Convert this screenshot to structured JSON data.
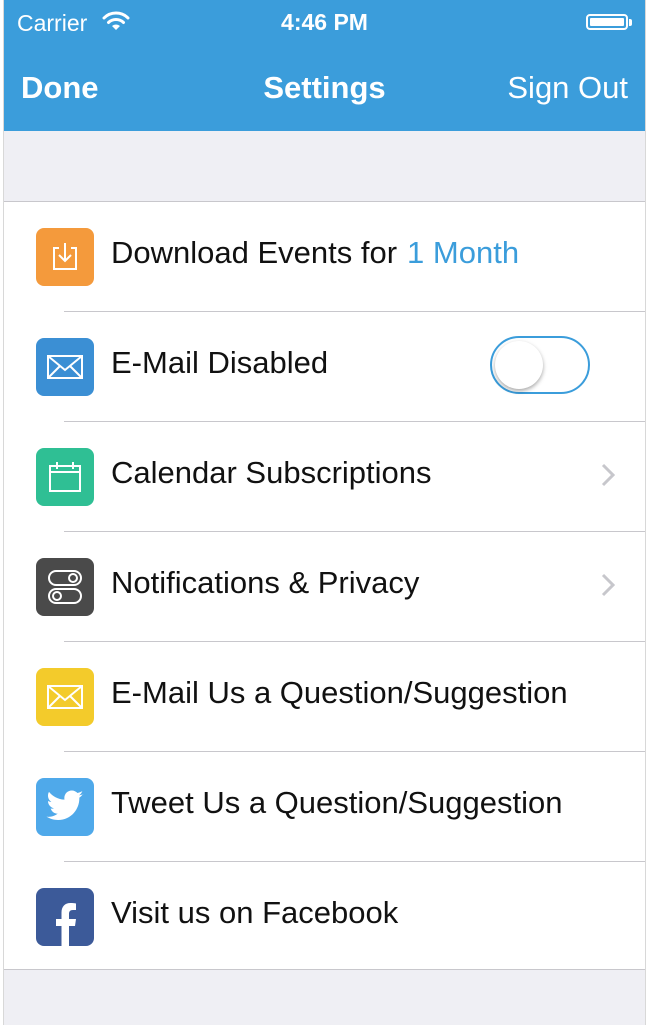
{
  "status_bar": {
    "carrier": "Carrier",
    "time": "4:46 PM"
  },
  "nav": {
    "left_button": "Done",
    "title": "Settings",
    "right_button": "Sign Out"
  },
  "colors": {
    "accent": "#3b9ddb",
    "background": "#efeff4"
  },
  "rows": [
    {
      "label": "Download Events for",
      "value": "1 Month",
      "icon": "download-icon",
      "icon_color": "#f49a3c"
    },
    {
      "label": "E-Mail Disabled",
      "icon": "envelope-icon",
      "icon_color": "#3b8fd4",
      "toggle_on": false
    },
    {
      "label": "Calendar Subscriptions",
      "icon": "calendar-icon",
      "icon_color": "#2fbf94"
    },
    {
      "label": "Notifications & Privacy",
      "icon": "switches-icon",
      "icon_color": "#4a4a4a"
    },
    {
      "label": "E-Mail Us a Question/Suggestion",
      "icon": "envelope-icon",
      "icon_color": "#f3cb2b"
    },
    {
      "label": "Tweet Us a Question/Suggestion",
      "icon": "twitter-bird-icon",
      "icon_color": "#4fa9ea"
    },
    {
      "label": "Visit us on Facebook",
      "icon": "facebook-icon",
      "icon_color": "#3c5a99"
    }
  ]
}
